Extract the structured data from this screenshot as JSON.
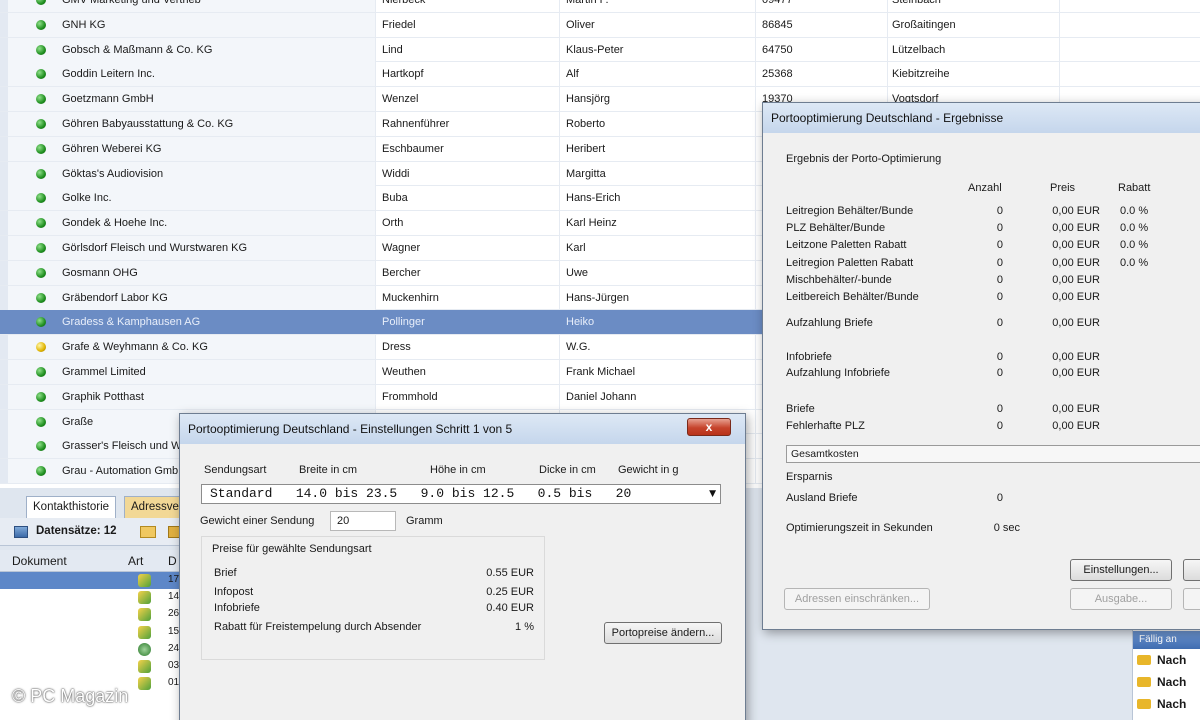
{
  "addresses": [
    {
      "status": "green",
      "company": "GMV Marketing und Vertrieb",
      "name": "Nierbeck",
      "first": "Martin P.",
      "zip": "09477",
      "city": "Steinbach"
    },
    {
      "status": "green",
      "company": "GNH KG",
      "name": "Friedel",
      "first": "Oliver",
      "zip": "86845",
      "city": "Großaitingen"
    },
    {
      "status": "green",
      "company": "Gobsch & Maßmann & Co. KG",
      "name": "Lind",
      "first": "Klaus-Peter",
      "zip": "64750",
      "city": "Lützelbach"
    },
    {
      "status": "green",
      "company": "Goddin Leitern Inc.",
      "name": "Hartkopf",
      "first": "Alf",
      "zip": "25368",
      "city": "Kiebitzreihe"
    },
    {
      "status": "green",
      "company": "Goetzmann GmbH",
      "name": "Wenzel",
      "first": "Hansjörg",
      "zip": "19370",
      "city": "Vogtsdorf"
    },
    {
      "status": "green",
      "company": "Göhren Babyausstattung & Co. KG",
      "name": "Rahnenführer",
      "first": "Roberto",
      "zip": "",
      "city": ""
    },
    {
      "status": "green",
      "company": "Göhren Weberei KG",
      "name": "Eschbaumer",
      "first": "Heribert",
      "zip": "",
      "city": ""
    },
    {
      "status": "green",
      "company": "Göktas's Audiovision",
      "name": "Widdi",
      "first": "Margitta",
      "zip": "",
      "city": ""
    },
    {
      "status": "green",
      "company": "Golke Inc.",
      "name": "Buba",
      "first": "Hans-Erich",
      "zip": "",
      "city": ""
    },
    {
      "status": "green",
      "company": "Gondek & Hoehe Inc.",
      "name": "Orth",
      "first": "Karl Heinz",
      "zip": "",
      "city": ""
    },
    {
      "status": "green",
      "company": "Görlsdorf Fleisch und Wurstwaren KG",
      "name": "Wagner",
      "first": "Karl",
      "zip": "",
      "city": ""
    },
    {
      "status": "green",
      "company": "Gosmann OHG",
      "name": "Bercher",
      "first": "Uwe",
      "zip": "",
      "city": ""
    },
    {
      "status": "green",
      "company": "Gräbendorf Labor KG",
      "name": "Muckenhirn",
      "first": "Hans-Jürgen",
      "zip": "",
      "city": ""
    },
    {
      "status": "green",
      "company": "Gradess & Kamphausen AG",
      "name": "Pollinger",
      "first": "Heiko",
      "zip": "",
      "city": "",
      "selected": true
    },
    {
      "status": "yellow",
      "company": "Grafe & Weyhmann & Co. KG",
      "name": "Dress",
      "first": "W.G.",
      "zip": "",
      "city": ""
    },
    {
      "status": "green",
      "company": "Grammel Limited",
      "name": "Weuthen",
      "first": "Frank Michael",
      "zip": "",
      "city": ""
    },
    {
      "status": "green",
      "company": "Graphik Potthast",
      "name": "Frommhold",
      "first": "Daniel Johann",
      "zip": "",
      "city": ""
    },
    {
      "status": "green",
      "company": "Graße",
      "name": "",
      "first": "",
      "zip": "",
      "city": ""
    },
    {
      "status": "green",
      "company": "Grasser's Fleisch und W",
      "name": "",
      "first": "",
      "zip": "",
      "city": ""
    },
    {
      "status": "green",
      "company": "Grau - Automation Gmb",
      "name": "",
      "first": "",
      "zip": "",
      "city": ""
    }
  ],
  "lower": {
    "tab_active": "Kontakthistorie",
    "tab_second": "Adressve",
    "records_label": "Datensätze: 12",
    "col_document": "Dokument",
    "col_type": "Art",
    "col_d": "D",
    "doc_numbers": [
      "17",
      "14",
      "26",
      "15",
      "24",
      "03",
      "01"
    ]
  },
  "right_strip": {
    "header": "Fällig an",
    "items": [
      "Nach",
      "Nach",
      "Nach"
    ]
  },
  "watermark": "© PC Magazin",
  "results": {
    "title": "Portooptimierung Deutschland - Ergebnisse",
    "section": "Ergebnis der Porto-Optimierung",
    "col_anzahl": "Anzahl",
    "col_preis": "Preis",
    "col_rabatt": "Rabatt",
    "rows": [
      {
        "label": "Leitregion Behälter/Bunde",
        "count": "0",
        "price": "0,00 EUR",
        "rabatt": "0.0 %"
      },
      {
        "label": "PLZ Behälter/Bunde",
        "count": "0",
        "price": "0,00 EUR",
        "rabatt": "0.0 %"
      },
      {
        "label": "Leitzone Paletten Rabatt",
        "count": "0",
        "price": "0,00 EUR",
        "rabatt": "0.0 %"
      },
      {
        "label": "Leitregion Paletten Rabatt",
        "count": "0",
        "price": "0,00 EUR",
        "rabatt": "0.0 %"
      },
      {
        "label": "Mischbehälter/-bunde",
        "count": "0",
        "price": "0,00 EUR",
        "rabatt": ""
      },
      {
        "label": "Leitbereich Behälter/Bunde",
        "count": "0",
        "price": "0,00 EUR",
        "rabatt": ""
      },
      {
        "label": "Aufzahlung Briefe",
        "count": "0",
        "price": "0,00 EUR",
        "rabatt": ""
      },
      {
        "label": "Infobriefe",
        "count": "0",
        "price": "0,00 EUR",
        "rabatt": ""
      },
      {
        "label": "Aufzahlung Infobriefe",
        "count": "0",
        "price": "0,00 EUR",
        "rabatt": ""
      },
      {
        "label": "Briefe",
        "count": "0",
        "price": "0,00 EUR",
        "rabatt": ""
      },
      {
        "label": "Fehlerhafte PLZ",
        "count": "0",
        "price": "0,00 EUR",
        "rabatt": ""
      }
    ],
    "gesamtkosten": "Gesamtkosten",
    "ersparnis": "Ersparnis",
    "ausland_label": "Ausland Briefe",
    "ausland_value": "0",
    "zeit_label": "Optimierungszeit in Sekunden",
    "zeit_value": "0 sec",
    "btn_einstellungen": "Einstellungen...",
    "btn_adressen": "Adressen einschränken...",
    "btn_ausgabe": "Ausgabe..."
  },
  "settings": {
    "title": "Portooptimierung Deutschland - Einstellungen Schritt 1 von 5",
    "close": "x",
    "h_sendungsart": "Sendungsart",
    "h_breite": "Breite in cm",
    "h_hoehe": "Höhe in cm",
    "h_dicke": "Dicke in cm",
    "h_gewicht": "Gewicht in g",
    "combo_value": "Standard   14.0 bis 23.5   9.0 bis 12.5   0.5 bis   20",
    "gewicht_label": "Gewicht einer Sendung",
    "gewicht_value": "20",
    "gewicht_unit": "Gramm",
    "preise_label": "Preise für gewählte Sendungsart",
    "preise": [
      {
        "label": "Brief",
        "value": "0.55 EUR"
      },
      {
        "label": "Infopost",
        "value": "0.25 EUR"
      },
      {
        "label": "Infobriefe",
        "value": "0.40 EUR"
      },
      {
        "label": "Rabatt für Freistempelung durch Absender",
        "value": "1 %"
      }
    ],
    "btn_portopreise": "Portopreise ändern..."
  }
}
